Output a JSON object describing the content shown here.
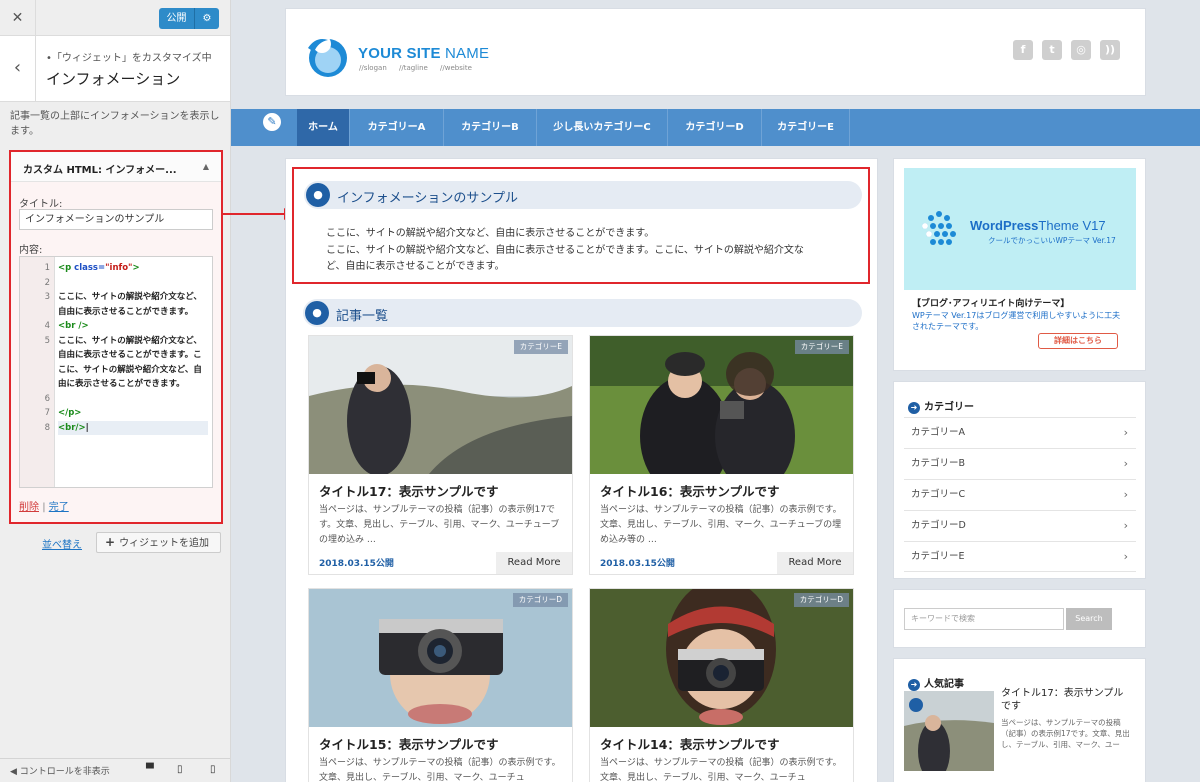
{
  "customizer": {
    "close_icon": "close-icon",
    "publish_label": "公開",
    "settings_icon": "gear-icon",
    "breadcrumb": "•「ウィジェット」をカスタマイズ中",
    "panel_title": "インフォメーション",
    "description": "記事一覧の上部にインフォメーションを表示します。",
    "widget": {
      "header": "カスタム HTML: インフォメー...",
      "title_label": "タイトル:",
      "title_value": "インフォメーションのサンプル",
      "content_label": "内容:",
      "delete_label": "削除",
      "separator": "|",
      "done_label": "完了"
    },
    "code_lines": [
      {
        "n": "1",
        "parts": [
          [
            "tag",
            "<p "
          ],
          [
            "attr",
            "class="
          ],
          [
            "str",
            "\"info\""
          ],
          [
            "tag",
            ">"
          ]
        ]
      },
      {
        "n": "2",
        "parts": []
      },
      {
        "n": "3",
        "parts": [
          [
            "plain",
            "ここに、サイトの解説や紹介文など、"
          ]
        ]
      },
      {
        "n": "",
        "parts": [
          [
            "plain",
            "自由に表示させることができます。"
          ]
        ]
      },
      {
        "n": "4",
        "parts": [
          [
            "tag",
            "<br />"
          ]
        ]
      },
      {
        "n": "5",
        "parts": [
          [
            "plain",
            "ここに、サイトの解説や紹介文など、"
          ]
        ]
      },
      {
        "n": "",
        "parts": [
          [
            "plain",
            "自由に表示させることができます。こ"
          ]
        ]
      },
      {
        "n": "",
        "parts": [
          [
            "plain",
            "こに、サイトの解説や紹介文など、自"
          ]
        ]
      },
      {
        "n": "",
        "parts": [
          [
            "plain",
            "由に表示させることができます。"
          ]
        ]
      },
      {
        "n": "6",
        "parts": []
      },
      {
        "n": "7",
        "parts": [
          [
            "tag",
            "</p>"
          ]
        ]
      },
      {
        "n": "8",
        "parts": [
          [
            "tag",
            "<br/>"
          ],
          [
            "plain",
            "|"
          ]
        ],
        "active": true
      }
    ],
    "reorder_label": "並べ替え",
    "add_widget_label": "ウィジェットを追加",
    "hide_controls_label": "コントロールを非表示"
  },
  "site": {
    "name_bold": "YOUR SITE",
    "name_light": " NAME",
    "tagline": "//slogan //tagline //website",
    "social_icons": [
      "facebook-icon",
      "twitter-icon",
      "instagram-icon",
      "rss-icon"
    ]
  },
  "nav": {
    "edit_icon": "pencil-icon",
    "items": [
      "ホーム",
      "カテゴリーA",
      "カテゴリーB",
      "少し長いカテゴリーC",
      "カテゴリーD",
      "カテゴリーE"
    ]
  },
  "info": {
    "title": "インフォメーションのサンプル",
    "line1": "ここに、サイトの解説や紹介文など、自由に表示させることができます。",
    "line2": "ここに、サイトの解説や紹介文など、自由に表示させることができます。ここに、サイトの解説や紹介文な",
    "line3": "ど、自由に表示させることができます。"
  },
  "articles": {
    "heading": "記事一覧",
    "items": [
      {
        "category": "カテゴリーE",
        "title": "タイトル17：表示サンプルです",
        "excerpt": "当ページは、サンプルテーマの投稿（記事）の表示例17です。文章、見出し、テーブル、引用、マーク、ユーチューブの埋め込み …",
        "date": "2018.03.15公開",
        "more": "Read More"
      },
      {
        "category": "カテゴリーE",
        "title": "タイトル16：表示サンプルです",
        "excerpt": "当ページは、サンプルテーマの投稿（記事）の表示例です。文章、見出し、テーブル、引用、マーク、ユーチューブの埋め込み等の …",
        "date": "2018.03.15公開",
        "more": "Read More"
      },
      {
        "category": "カテゴリーD",
        "title": "タイトル15：表示サンプルです",
        "excerpt": "当ページは、サンプルテーマの投稿（記事）の表示例です。文章、見出し、テーブル、引用、マーク、ユーチュ",
        "date": "",
        "more": ""
      },
      {
        "category": "カテゴリーD",
        "title": "タイトル14：表示サンプルです",
        "excerpt": "当ページは、サンプルテーマの投稿（記事）の表示例です。文章、見出し、テーブル、引用、マーク、ユーチュ",
        "date": "",
        "more": ""
      }
    ]
  },
  "sidebar": {
    "ad": {
      "brand_bold": "WordPress",
      "brand_rest": "Theme V17",
      "sub": "クールでかっこいいWPテーマ Ver.17",
      "heading": "【ブログ･アフィリエイト向けテーマ】",
      "text": "WPテーマ Ver.17はブログ運営で利用しやすいように工夫されたテーマです。",
      "button": "詳細はこちら"
    },
    "categories_title": "カテゴリー",
    "categories": [
      "カテゴリーA",
      "カテゴリーB",
      "カテゴリーC",
      "カテゴリーD",
      "カテゴリーE"
    ],
    "search_placeholder": "キーワードで検索",
    "search_button": "Search",
    "popular_title": "人気記事",
    "popular_item_title": "タイトル17：表示サンプルです",
    "popular_item_excerpt": "当ページは、サンプルテーマの投稿（記事）の表示例17です。文章、見出し、テーブル、引用、マーク、ユー"
  },
  "colors": {
    "accent_blue": "#1f5fa5",
    "nav_blue": "#4f8fcc",
    "highlight_red": "#e0262c",
    "publish_blue": "#2e8bc9"
  }
}
